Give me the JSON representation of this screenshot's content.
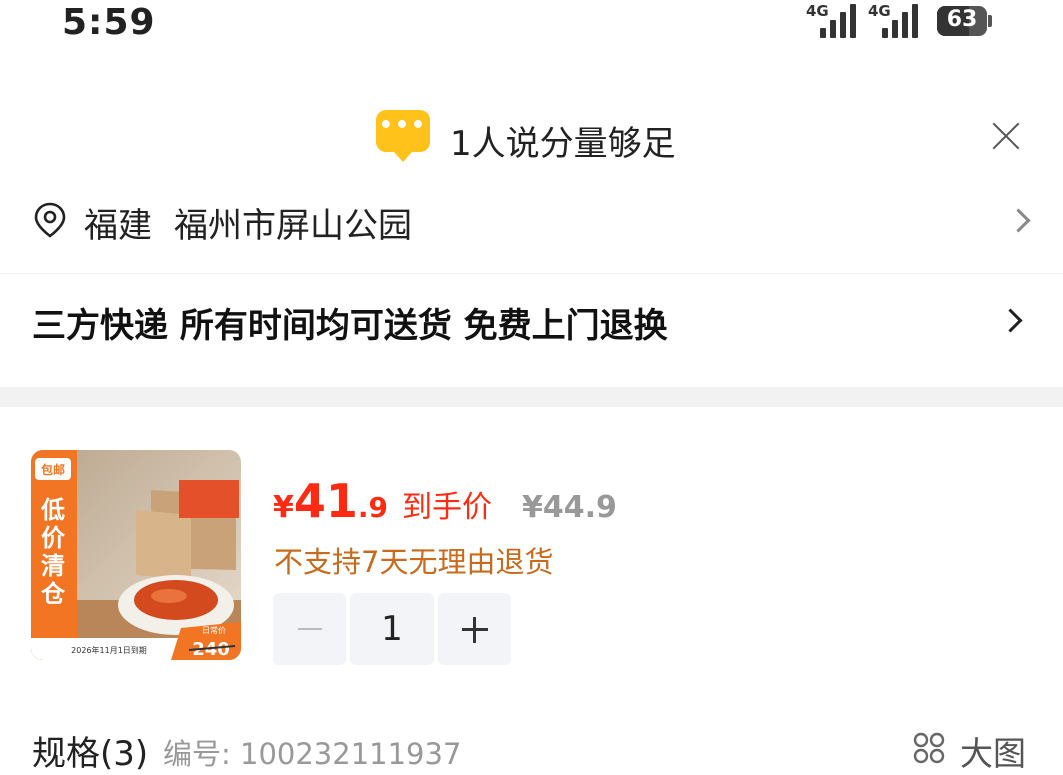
{
  "status_bar": {
    "time": "5:59",
    "signal1_label": "4G",
    "signal2_label": "4G",
    "battery": "63"
  },
  "header": {
    "icon": "chat-bubble-icon",
    "title": "1人说分量够足"
  },
  "address": {
    "province": "福建",
    "detail": "福州市屏山公园"
  },
  "delivery": {
    "text": "三方快递 所有时间均可送货 免费上门退换"
  },
  "product": {
    "image_badges": {
      "top": "包邮",
      "side": "低价清仓",
      "bottom_date": "2026年11月1日到期",
      "corner_price_label": "日常价",
      "corner_price": "240"
    },
    "price": {
      "symbol": "¥",
      "integer": "41",
      "decimal": ".9",
      "label": "到手价",
      "original": "¥44.9"
    },
    "policy": "不支持7天无理由退货",
    "quantity": "1"
  },
  "spec": {
    "label": "规格(3)",
    "code": "编号: 100232111937",
    "view_big_label": "大图"
  },
  "colors": {
    "accent_red": "#ff2a12",
    "policy_orange": "#c96a1c",
    "bubble_yellow": "#ffc21a"
  }
}
